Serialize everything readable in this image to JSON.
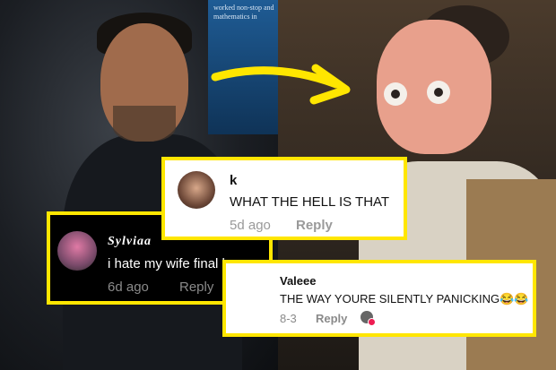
{
  "left_photo": {
    "sign_text": "worked non-stop and mathematics in"
  },
  "comments": {
    "k": {
      "username": "k",
      "text": "WHAT THE HELL IS THAT",
      "time": "5d ago",
      "reply_label": "Reply"
    },
    "sylvia": {
      "username": "Sylviaa",
      "text": "i hate my wife final boss",
      "time": "6d ago",
      "reply_label": "Reply"
    },
    "valeee": {
      "username": "Valeee",
      "text": "THE WAY YOURE SILENTLY PANICKING😂😂",
      "time": "8-3",
      "reply_label": "Reply"
    }
  },
  "colors": {
    "highlight_border": "#ffe600",
    "arrow": "#ffe600",
    "tiktok_heart": "#ee1d52"
  }
}
